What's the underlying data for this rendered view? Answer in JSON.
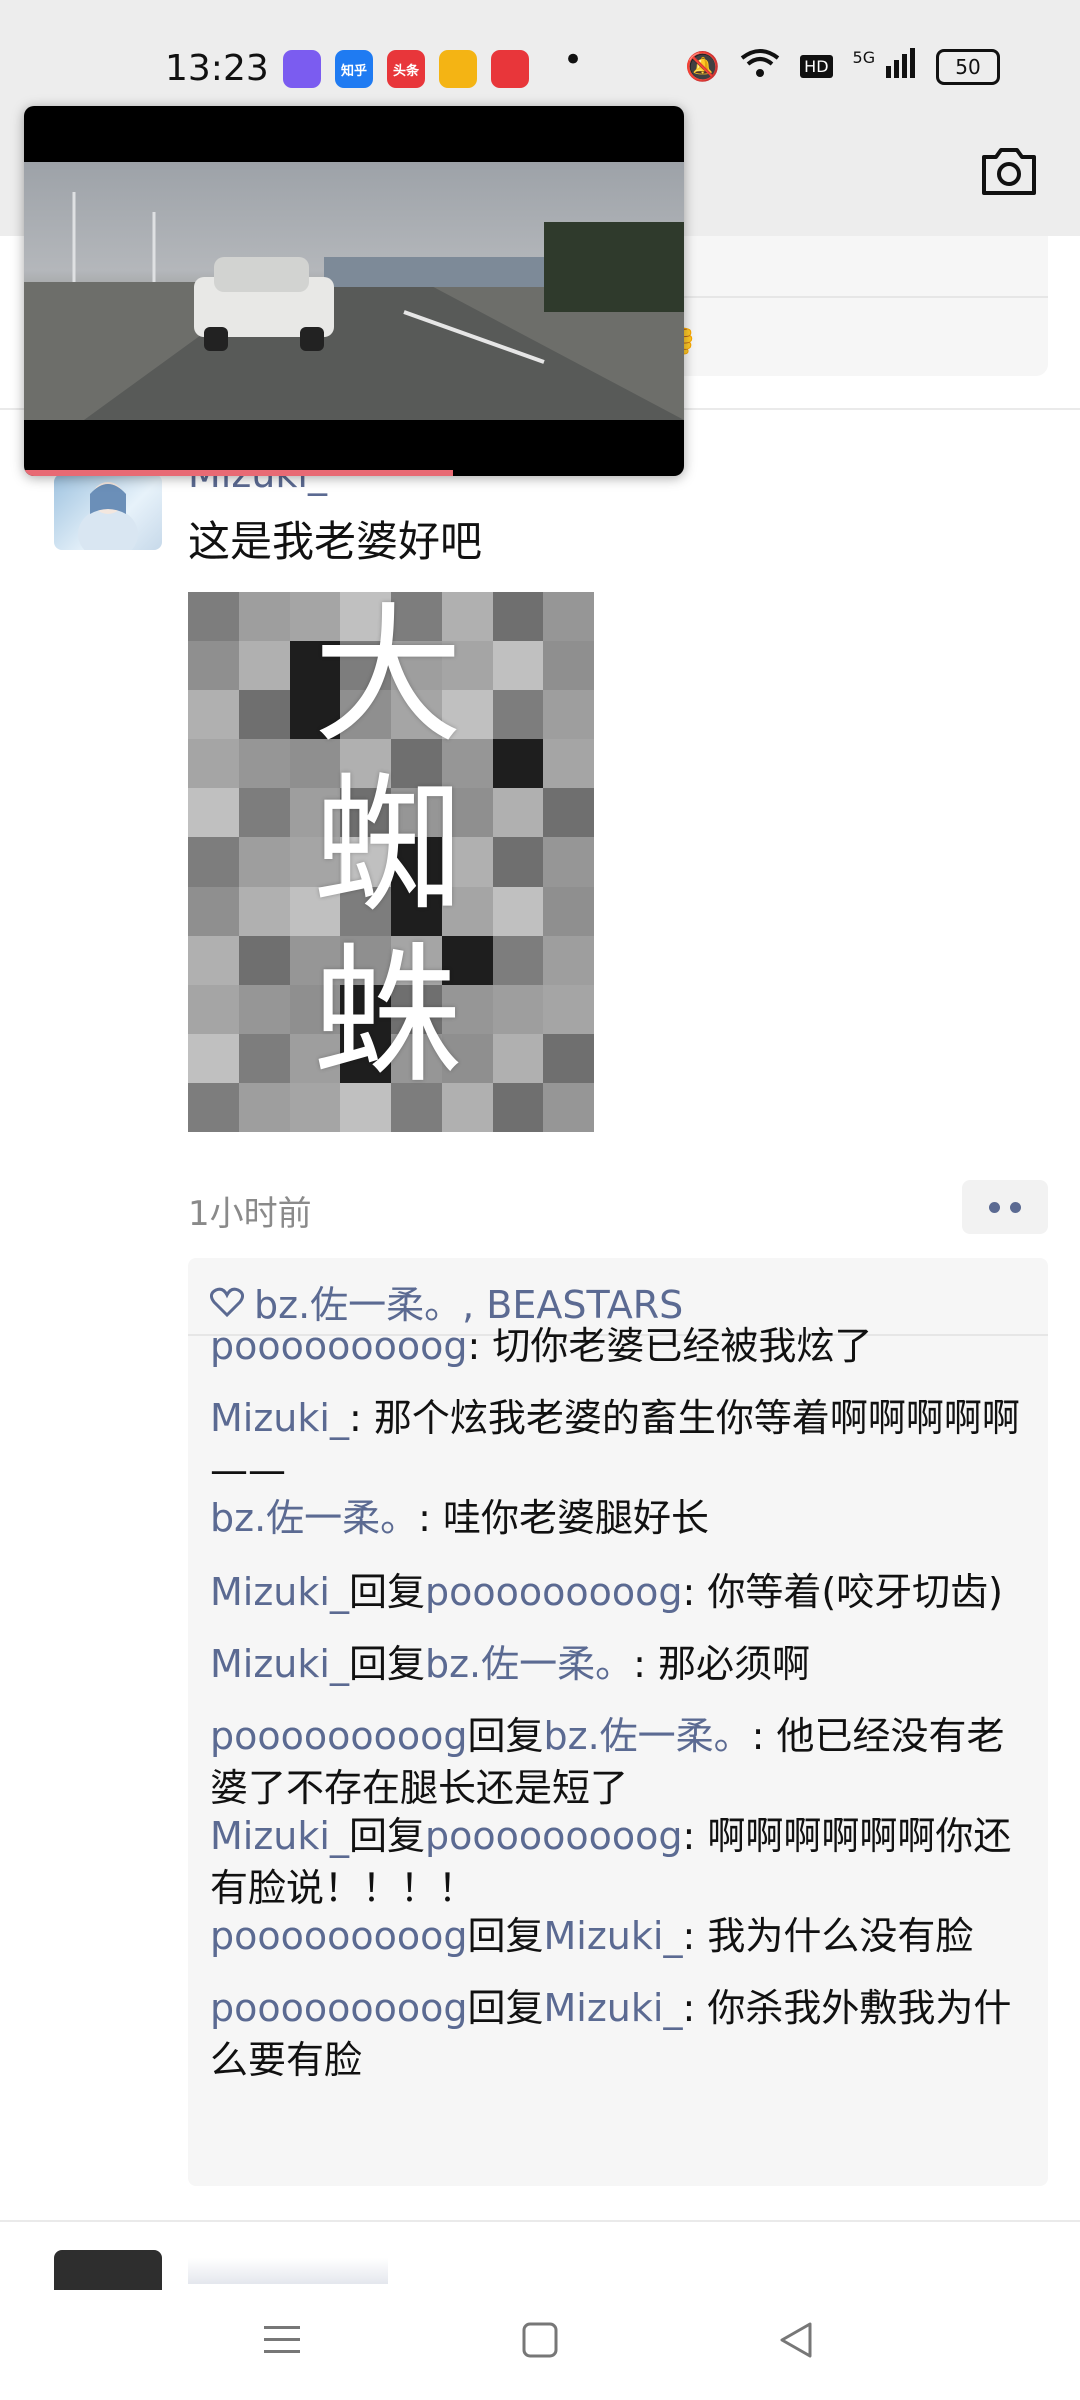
{
  "status_bar": {
    "time": "13:23",
    "apps": [
      {
        "name": "app-icon-1",
        "text": "",
        "color": "#7b5cf0"
      },
      {
        "name": "zhihu-icon",
        "text": "知乎",
        "color": "#1f7bf2"
      },
      {
        "name": "toutiao-icon",
        "text": "头条",
        "color": "#e8363a"
      },
      {
        "name": "weibo-icon",
        "text": "",
        "color": "#f4b414"
      },
      {
        "name": "video-app-icon",
        "text": "",
        "color": "#e8363a"
      }
    ],
    "battery": "50",
    "network": "5G",
    "hd": "HD"
  },
  "post": {
    "author": "Mizuki_",
    "text": "这是我老婆好吧",
    "image_chars": [
      "大",
      "蜘",
      "蛛"
    ],
    "time": "1小时前"
  },
  "comments": {
    "likes": "bz.佐一柔。, BEASTARS",
    "items": [
      {
        "name": "pooooooooog",
        "reply_to": "",
        "text": ": 切你老婆已经被我炫了"
      },
      {
        "name": "Mizuki_",
        "reply_to": "",
        "text": ": 那个炫我老婆的畜生你等着啊啊啊啊啊——"
      },
      {
        "name": "bz.佐一柔。",
        "reply_to": "",
        "text": ": 哇你老婆腿好长"
      },
      {
        "name": "Mizuki_",
        "reply_to": "pooooooooog",
        "text": ": 你等着(咬牙切齿)"
      },
      {
        "name": "Mizuki_",
        "reply_to": "bz.佐一柔。",
        "text": ": 那必须啊"
      },
      {
        "name": "pooooooooog",
        "reply_to": "bz.佐一柔。",
        "text": ": 他已经没有老婆了不存在腿长还是短了"
      },
      {
        "name": "Mizuki_",
        "reply_to": "pooooooooog",
        "text": ": 啊啊啊啊啊啊你还有脸说！！！！"
      },
      {
        "name": "pooooooooog",
        "reply_to": "Mizuki_",
        "text": ": 我为什么没有脸"
      },
      {
        "name": "pooooooooog",
        "reply_to": "Mizuki_",
        "text": ": 你杀我外敷我为什么要有脸"
      }
    ],
    "reply_word": "回复"
  },
  "video": {
    "progress": 0.65
  },
  "colors": {
    "link": "#5b6a92",
    "progress": "#e86a74"
  }
}
